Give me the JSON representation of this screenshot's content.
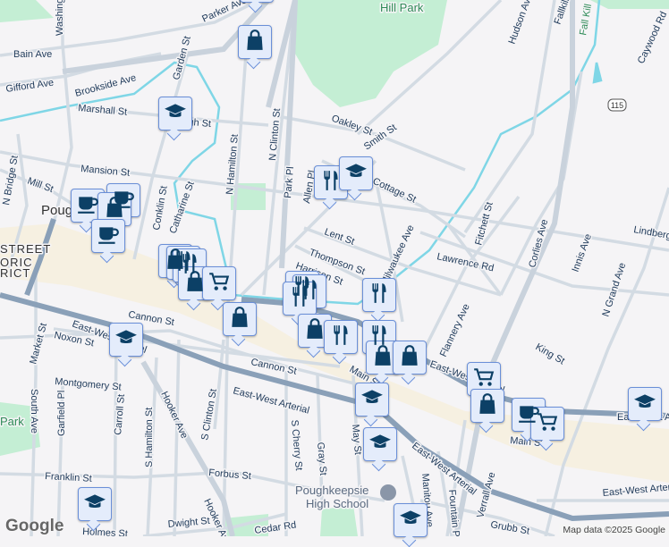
{
  "map": {
    "streets": [
      "Parker Ave",
      "Bain Ave",
      "Gifford Ave",
      "Brookside Ave",
      "Marshall St",
      "Garden St",
      "Washington St",
      "N Hamilton St",
      "N Clinton St",
      "Mansion St",
      "Mill St",
      "N Bridge St",
      "Conklin St",
      "Catharine St",
      "Park Pl",
      "Allen Pl",
      "Oakley St",
      "Smith St",
      "Cottage St",
      "Lent St",
      "Thompson St",
      "Harrison St",
      "Lawrence Rd",
      "Fitchett St",
      "Corlies Ave",
      "Innis Ave",
      "Hudson Ave",
      "Fallkill",
      "Caywood Rd",
      "Lindbergh",
      "N Grand Ave",
      "King St",
      "Flannery Ave",
      "Milwaukee Ave",
      "Cannon St",
      "Noxon St",
      "Market St",
      "Montgomery St",
      "South Ave",
      "Garfield Pl",
      "Carroll St",
      "S Hamilton St",
      "Hooker Ave",
      "S Clinton St",
      "S Cherry St",
      "Gray St",
      "May St",
      "Manitou Ave",
      "Fountain Pl",
      "Franklin St",
      "Forbus St",
      "Dwight St",
      "Grubb St",
      "East-West Arterial",
      "Main St",
      "Verrall Ave",
      "Hough St",
      "Fall Kill",
      "Holmes St",
      "Cedar Rd"
    ],
    "places": {
      "city": "Poughkeepsie",
      "park_top": "Hill Park",
      "park_left": "Park",
      "district_1": "STREET",
      "district_2": "ORIC",
      "district_3": "RICT",
      "school_1": "Poughkeepsie",
      "school_2": "High School",
      "route": "115"
    },
    "markers": [
      {
        "type": "cart"
      },
      {
        "type": "bag"
      },
      {
        "type": "education"
      },
      {
        "type": "coffee"
      },
      {
        "type": "coffee"
      },
      {
        "type": "bag"
      },
      {
        "type": "coffee"
      },
      {
        "type": "bag"
      },
      {
        "type": "restaurant"
      },
      {
        "type": "restaurant"
      },
      {
        "type": "bag"
      },
      {
        "type": "cart"
      },
      {
        "type": "bag"
      },
      {
        "type": "restaurant"
      },
      {
        "type": "education"
      },
      {
        "type": "restaurant"
      },
      {
        "type": "restaurant"
      },
      {
        "type": "restaurant"
      },
      {
        "type": "bag"
      },
      {
        "type": "restaurant"
      },
      {
        "type": "restaurant"
      },
      {
        "type": "restaurant"
      },
      {
        "type": "bag"
      },
      {
        "type": "bag"
      },
      {
        "type": "cart"
      },
      {
        "type": "bag"
      },
      {
        "type": "coffee"
      },
      {
        "type": "cart"
      },
      {
        "type": "education"
      },
      {
        "type": "education"
      },
      {
        "type": "education"
      },
      {
        "type": "education"
      },
      {
        "type": "education"
      },
      {
        "type": "education"
      }
    ],
    "colors": {
      "background": "#f5f4f6",
      "park": "#c4eed4",
      "arterial": "#8aa0b8",
      "road": "#d3dbe3",
      "water": "#7fd6e6",
      "marker_icon": "#0c4066",
      "marker_bg": "#e4ecfb",
      "downtown": "#f6efdc"
    }
  },
  "footer": {
    "logo": "Google",
    "attribution": "Map data ©2025 Google"
  }
}
